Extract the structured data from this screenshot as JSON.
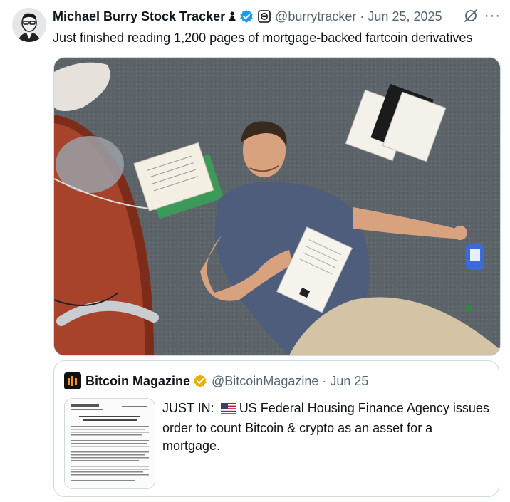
{
  "tweet": {
    "author_name": "Michael Burry Stock Tracker",
    "author_handle": "@burrytracker",
    "separator": "·",
    "date": "Jun 25, 2025",
    "more_label": "···",
    "text": "Just finished reading 1,200 pages of mortgage-backed fartcoin derivatives",
    "icons": [
      "avatar",
      "chess-pawn-icon",
      "verified-badge-icon",
      "robot-badge-icon",
      "grok-icon",
      "more-icon"
    ],
    "verified_color": "#1d9bf0"
  },
  "media": {
    "description_icon": "man-lying-on-floor-with-papers-photo"
  },
  "quote": {
    "author_name": "Bitcoin Magazine",
    "author_handle": "@BitcoinMagazine",
    "separator": "·",
    "date": "Jun 25",
    "text_before_flag": "JUST IN: ",
    "text_after_flag": "US Federal Housing Finance Agency issues order to count Bitcoin & crypto as an asset for a mortgage.",
    "verified_color": "#e8b000",
    "icons": [
      "bitcoin-magazine-logo-icon",
      "gold-verified-badge-icon",
      "us-flag-icon"
    ],
    "thumbnail_icon": "document-thumbnail"
  },
  "colors": {
    "text_primary": "#0f1419",
    "text_secondary": "#536471",
    "border": "#cfd9de"
  }
}
